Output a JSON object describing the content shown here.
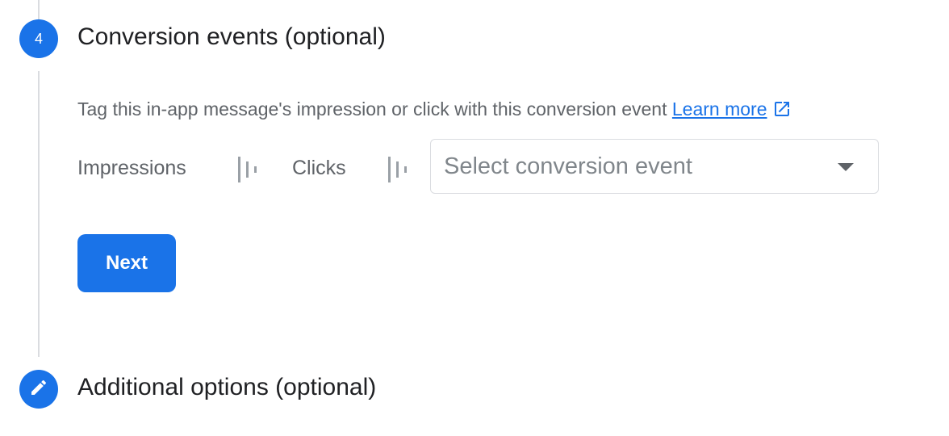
{
  "step4": {
    "number": "4",
    "title": "Conversion events (optional)",
    "description": "Tag this in-app message's impression or click with this conversion event",
    "learn_more": "Learn more",
    "impressions_label": "Impressions",
    "clicks_label": "Clicks",
    "select_placeholder": "Select conversion event",
    "next_label": "Next"
  },
  "step5": {
    "icon": "pencil-icon",
    "title": "Additional options (optional)"
  },
  "colors": {
    "accent": "#1a73e8",
    "text_primary": "#202124",
    "text_secondary": "#5f6368",
    "placeholder": "#80868b",
    "border": "#dadce0"
  }
}
